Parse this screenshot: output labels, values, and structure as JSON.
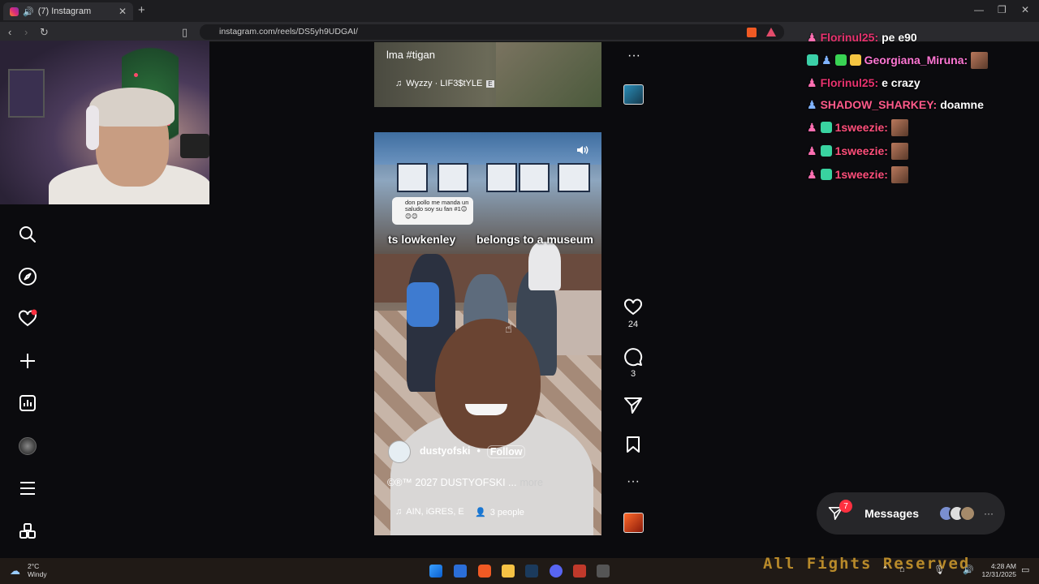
{
  "browser": {
    "tab_title": "(7) Instagram",
    "url": "instagram.com/reels/DS5yh9UDGAI/",
    "new_tab_label": "+",
    "close_tab_label": "✕"
  },
  "previous_reel": {
    "caption": "lma #tigan",
    "music": "Wyzzy · LIF3$tYLE",
    "explicit_badge": "E"
  },
  "reel": {
    "comment_screenshot_text": "don pollo me manda un saludo soy su fan #1😊😊😊",
    "overlay_left": "ts lowkenley",
    "overlay_right": "belongs to a museum",
    "username": "dustyofski",
    "separator": "•",
    "follow_label": "Follow",
    "caption": "©®™ 2027 DUSTYOFSKI ...",
    "more_label": "more",
    "music": "AIN, iGRES, E",
    "people": "3 people"
  },
  "actions": {
    "likes": "24",
    "comments": "3"
  },
  "chat": [
    {
      "user": "Florinul25:",
      "msg": "pe e90",
      "user_color": "#e8336f"
    },
    {
      "user": "Georgiana_Miruna:",
      "msg": "",
      "user_color": "#ff77d5"
    },
    {
      "user": "Florinul25:",
      "msg": "e crazy",
      "user_color": "#e8336f"
    },
    {
      "user": "SHADOW_SHARKEY:",
      "msg": "doamne",
      "user_color": "#ff5a8a"
    },
    {
      "user": "1sweezie:",
      "msg": "",
      "user_color": "#ff4f7b"
    },
    {
      "user": "1sweezie:",
      "msg": "",
      "user_color": "#ff4f7b"
    },
    {
      "user": "1sweezie:",
      "msg": "",
      "user_color": "#ff4f7b"
    }
  ],
  "messages": {
    "label": "Messages",
    "count": "7",
    "more": "···"
  },
  "taskbar": {
    "temp": "2°C",
    "weather": "Windy",
    "time": "4:28 AM",
    "date": "12/31/2025",
    "background_text": "All Fights Reserved"
  },
  "colors": {
    "notification_red": "#ff3040",
    "chat_pink": "#e8336f"
  }
}
